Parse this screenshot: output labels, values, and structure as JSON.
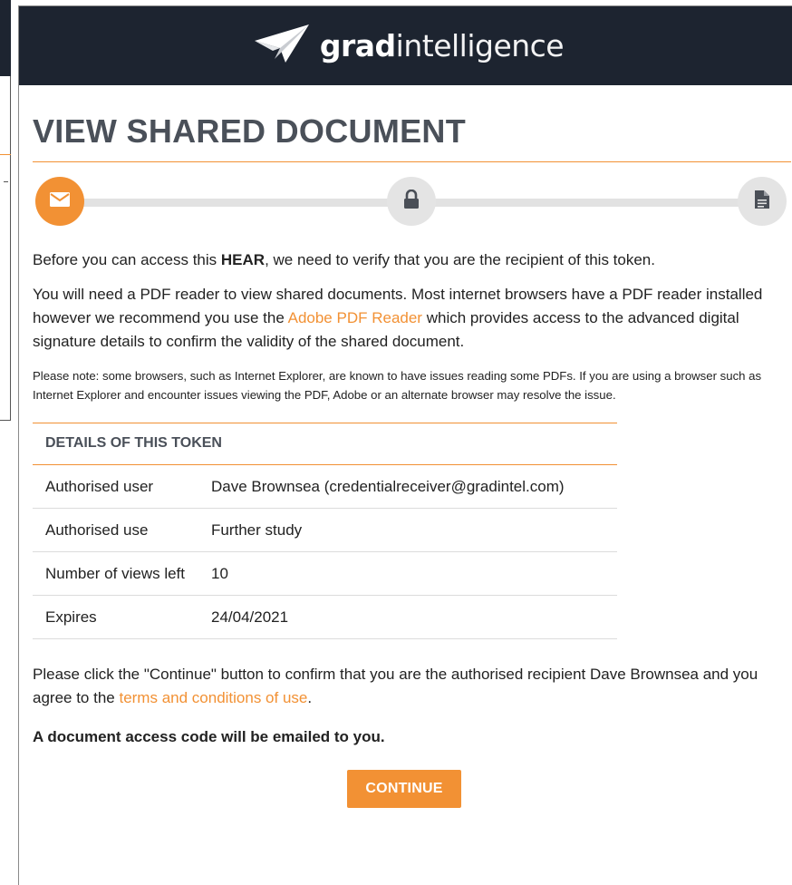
{
  "brand": {
    "name_bold": "grad",
    "name_light": "intelligence"
  },
  "page": {
    "title": "VIEW SHARED DOCUMENT"
  },
  "stepper": {
    "steps": [
      {
        "icon": "envelope-icon",
        "state": "active"
      },
      {
        "icon": "lock-icon",
        "state": "inactive"
      },
      {
        "icon": "document-icon",
        "state": "inactive"
      }
    ]
  },
  "intro": {
    "before": "Before you can access this ",
    "bold": "HEAR",
    "after": ", we need to verify that you are the recipient of this token."
  },
  "pdf": {
    "before": "You will need a PDF reader to view shared documents. Most internet browsers have a PDF reader installed however we recommend you use the ",
    "link": "Adobe PDF Reader",
    "after": " which provides access to the advanced digital signature details to confirm the validity of the shared document."
  },
  "note": "Please note: some browsers, such as Internet Explorer, are known to have issues reading some PDFs. If you are using a browser such as Internet Explorer and encounter issues viewing the PDF, Adobe or an alternate browser may resolve the issue.",
  "details": {
    "heading": "DETAILS OF THIS TOKEN",
    "rows": [
      {
        "key": "Authorised user",
        "value": "Dave Brownsea (credentialreceiver@gradintel.com)"
      },
      {
        "key": "Authorised use",
        "value": "Further study"
      },
      {
        "key": "Number of views left",
        "value": "10"
      },
      {
        "key": "Expires",
        "value": "24/04/2021"
      }
    ]
  },
  "confirm": {
    "before": "Please click the \"Continue\" button to confirm that you are the authorised recipient Dave Brownsea and you agree to the ",
    "link": "terms and conditions of use",
    "after": "."
  },
  "email_notice": "A document access code will be emailed to you.",
  "continue_label": "CONTINUE",
  "colors": {
    "accent": "#f29134",
    "header_bg": "#1d2430",
    "title": "#4a5059"
  }
}
